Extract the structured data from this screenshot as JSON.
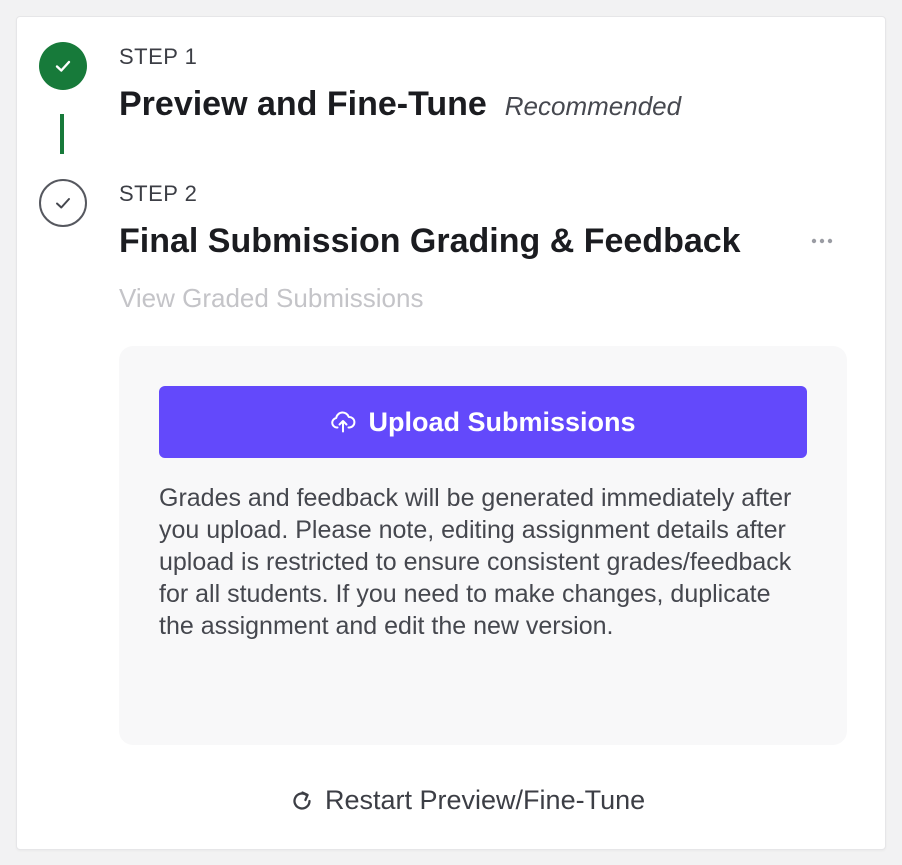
{
  "steps": [
    {
      "label": "STEP 1",
      "title": "Preview and Fine-Tune",
      "badge": "Recommended",
      "status": "complete",
      "icon": "check-icon"
    },
    {
      "label": "STEP 2",
      "title": "Final Submission Grading & Feedback",
      "status": "current",
      "icon": "check-icon",
      "link_label": "View Graded Submissions"
    }
  ],
  "upload": {
    "button_label": "Upload Submissions",
    "icon": "cloud-upload-icon",
    "note": "Grades and feedback will be generated immediately after you upload. Please note, editing assignment details after upload is restricted to ensure consistent grades/feedback for all students. If you need to make changes, duplicate the assignment and edit the new version."
  },
  "restart": {
    "label": "Restart Preview/Fine-Tune",
    "icon": "refresh-icon"
  },
  "colors": {
    "success": "#177a3a",
    "primary": "#6349fb",
    "muted_text": "#c4c4c8",
    "panel_bg": "#f8f8f9"
  }
}
